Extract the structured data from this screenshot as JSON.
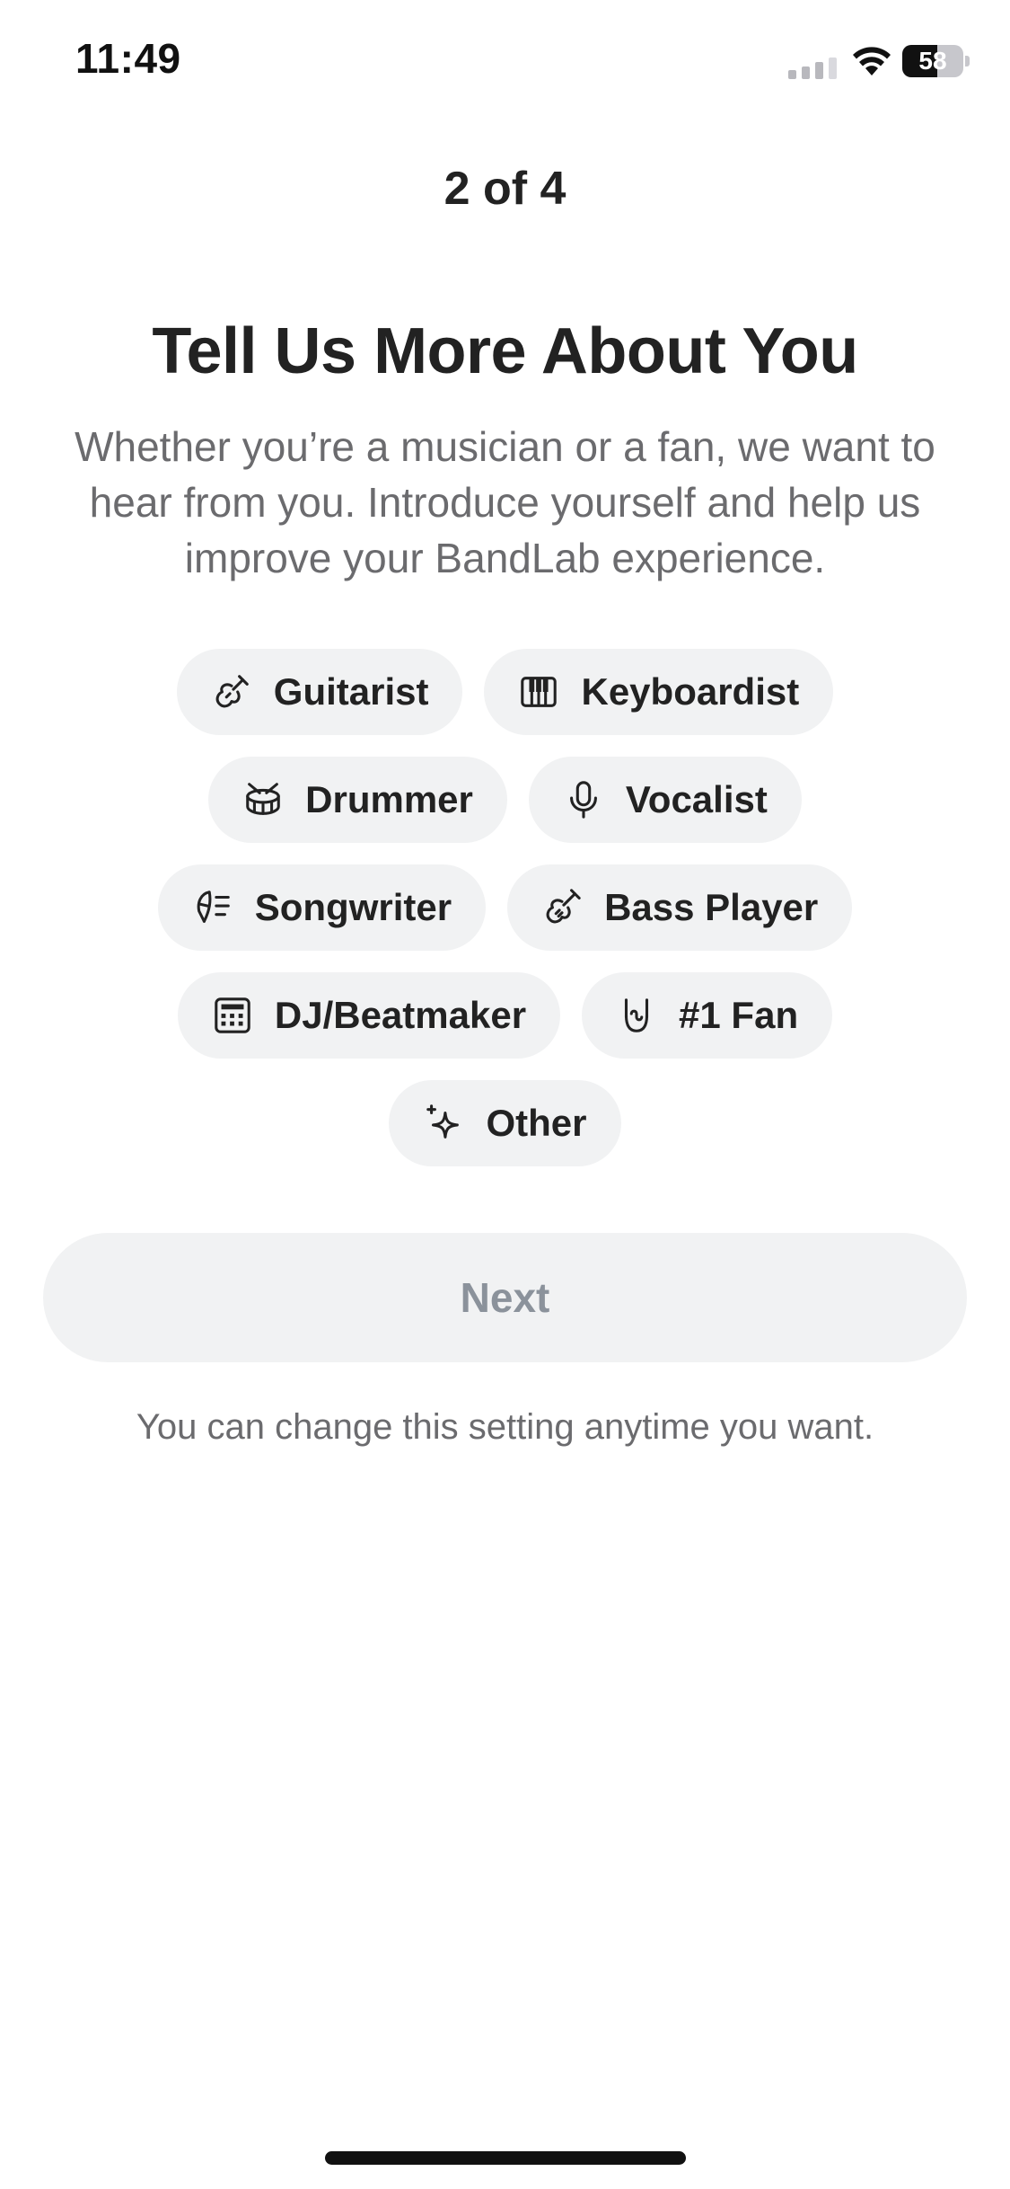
{
  "status_bar": {
    "time": "11:49",
    "battery_level": "58",
    "battery_fraction": 0.58
  },
  "onboarding": {
    "step": "2 of 4",
    "title": "Tell Us More About You",
    "subtitle": "Whether you’re a musician or a fan, we want to hear from you. Introduce yourself and help us improve your BandLab experience.",
    "options": [
      {
        "label": "Guitarist",
        "icon": "guitar-icon"
      },
      {
        "label": "Keyboardist",
        "icon": "piano-keys-icon"
      },
      {
        "label": "Drummer",
        "icon": "drum-icon"
      },
      {
        "label": "Vocalist",
        "icon": "microphone-icon"
      },
      {
        "label": "Songwriter",
        "icon": "feather-quill-icon"
      },
      {
        "label": "Bass Player",
        "icon": "bass-guitar-icon"
      },
      {
        "label": "DJ/Beatmaker",
        "icon": "drum-machine-icon"
      },
      {
        "label": "#1 Fan",
        "icon": "rock-hand-icon"
      },
      {
        "label": "Other",
        "icon": "sparkle-icon"
      }
    ],
    "next_label": "Next",
    "footnote": "You can change this setting anytime you want."
  },
  "colors": {
    "chip_background": "#f1f2f3",
    "text_primary": "#222222",
    "text_secondary": "#6b6b6e",
    "disabled_text": "#8b929b"
  }
}
